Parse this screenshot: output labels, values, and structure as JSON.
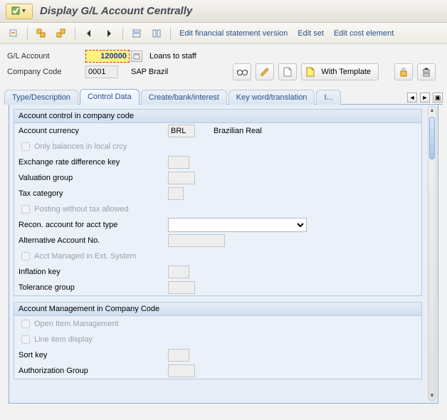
{
  "title": "Display G/L Account Centrally",
  "toolbar": {
    "edit_fsv": "Edit financial statement version",
    "edit_set": "Edit set",
    "edit_cost_element": "Edit cost element"
  },
  "header": {
    "gl_account_label": "G/L Account",
    "gl_account_value": "120000",
    "gl_account_desc": "Loans to staff",
    "company_code_label": "Company Code",
    "company_code_value": "0001",
    "company_code_desc": "SAP Brazil"
  },
  "actions": {
    "with_template": "With Template"
  },
  "tabs": [
    {
      "label": "Type/Description"
    },
    {
      "label": "Control Data"
    },
    {
      "label": "Create/bank/interest"
    },
    {
      "label": "Key word/translation"
    },
    {
      "label": "I..."
    }
  ],
  "groups": {
    "g1": {
      "title": "Account control in company code",
      "currency_label": "Account currency",
      "currency_value": "BRL",
      "currency_desc": "Brazilian Real",
      "only_balances": "Only balances in local crcy",
      "exch_rate": "Exchange rate difference key",
      "valuation": "Valuation group",
      "tax_cat": "Tax category",
      "posting_wo_tax": "Posting without tax allowed",
      "recon": "Recon. account for acct type",
      "alt_acct": "Alternative Account No.",
      "ext_system": "Acct Managed in Ext. System",
      "inflation": "Inflation key",
      "tolerance": "Tolerance group"
    },
    "g2": {
      "title": "Account Management in Company Code",
      "open_item": "Open Item Management",
      "line_item": "Line item display",
      "sort_key": "Sort key",
      "auth_group": "Authorization Group"
    }
  }
}
